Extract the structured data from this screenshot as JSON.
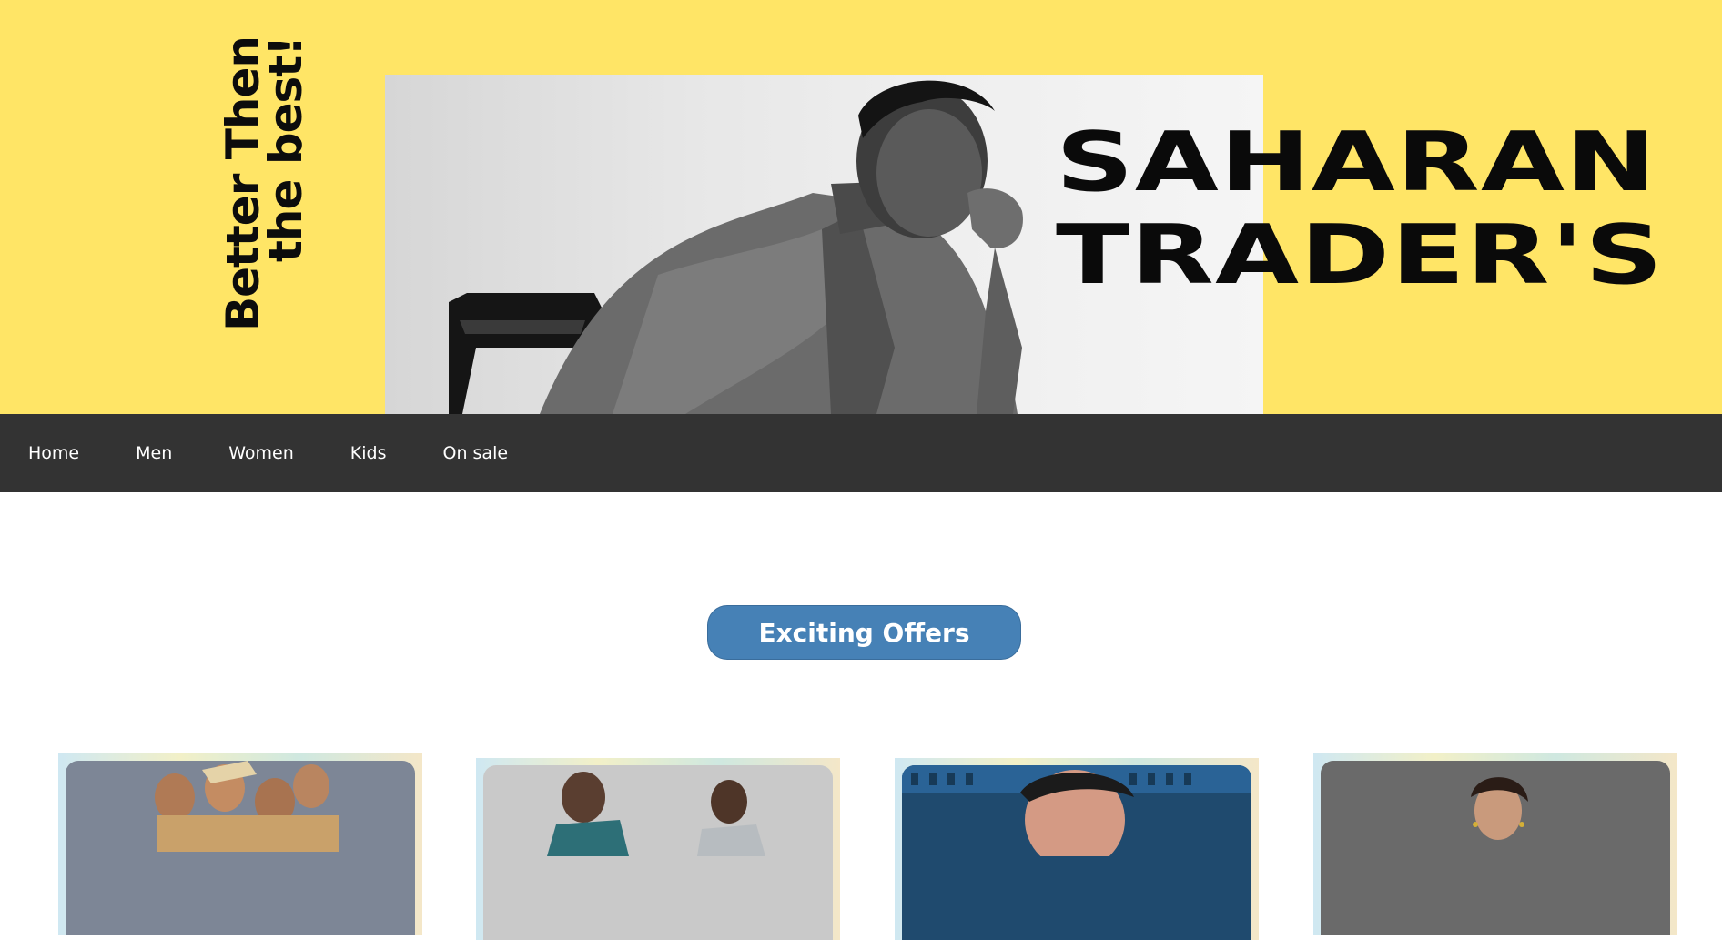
{
  "hero": {
    "tagline_line1": "Better Then",
    "tagline_line2": "the best!",
    "brand_line1": "SAHARAN",
    "brand_line2": "TRADER'S",
    "background_color": "#ffe566"
  },
  "nav": {
    "items": [
      {
        "label": "Home"
      },
      {
        "label": "Men"
      },
      {
        "label": "Women"
      },
      {
        "label": "Kids"
      },
      {
        "label": "On sale"
      }
    ]
  },
  "offers": {
    "button_label": "Exciting Offers",
    "button_color": "#4681b6"
  }
}
